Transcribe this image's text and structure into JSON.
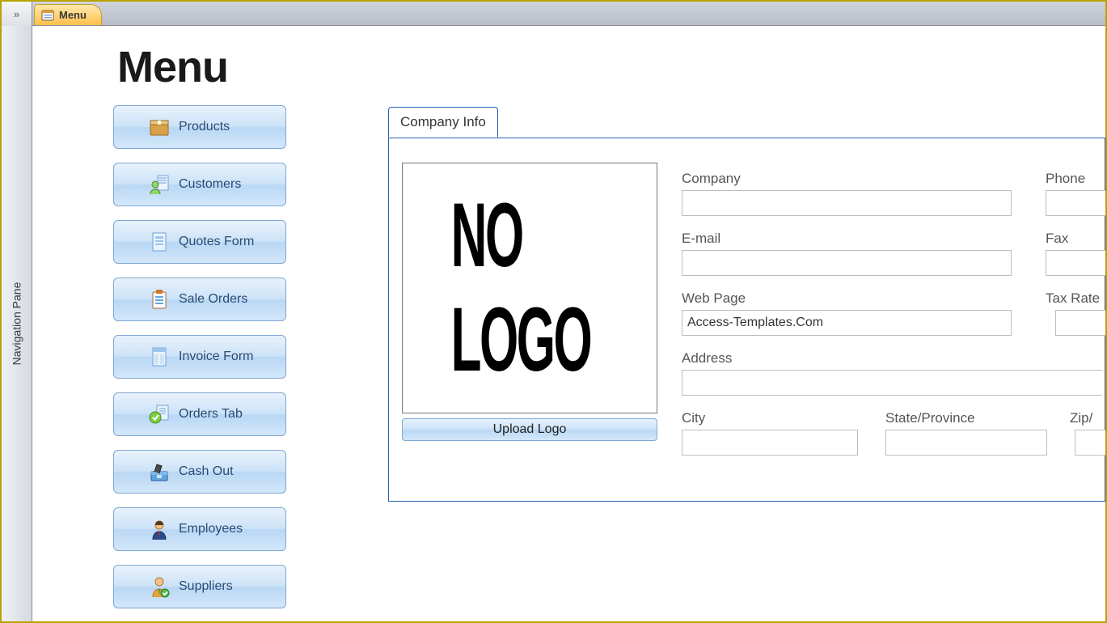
{
  "window": {
    "tab_label": "Menu",
    "nav_pane_label": "Navigation Pane",
    "expand_glyph": "»"
  },
  "page": {
    "title": "Menu"
  },
  "menu": {
    "items": [
      {
        "label": "Products",
        "icon": "box-icon"
      },
      {
        "label": "Customers",
        "icon": "person-icon"
      },
      {
        "label": "Quotes Form",
        "icon": "doc-icon"
      },
      {
        "label": "Sale Orders",
        "icon": "clipboard-icon"
      },
      {
        "label": "Invoice Form",
        "icon": "invoice-icon"
      },
      {
        "label": "Orders Tab",
        "icon": "check-icon"
      },
      {
        "label": "Cash Out",
        "icon": "cashbox-icon"
      },
      {
        "label": "Employees",
        "icon": "employee-icon"
      },
      {
        "label": "Suppliers",
        "icon": "supplier-icon"
      }
    ]
  },
  "form": {
    "tab_label": "Company Info",
    "logo_placeholder": "NO LOGO",
    "upload_label": "Upload Logo",
    "fields": {
      "company": {
        "label": "Company",
        "value": ""
      },
      "email": {
        "label": "E-mail",
        "value": ""
      },
      "webpage": {
        "label": "Web Page",
        "value": "Access-Templates.Com"
      },
      "address": {
        "label": "Address",
        "value": ""
      },
      "city": {
        "label": "City",
        "value": ""
      },
      "state": {
        "label": "State/Province",
        "value": ""
      },
      "zip": {
        "label": "Zip/",
        "value": ""
      },
      "phone": {
        "label": "Phone",
        "value": ""
      },
      "fax": {
        "label": "Fax",
        "value": ""
      },
      "taxrate": {
        "label": "Tax Rate",
        "value": ""
      }
    }
  }
}
